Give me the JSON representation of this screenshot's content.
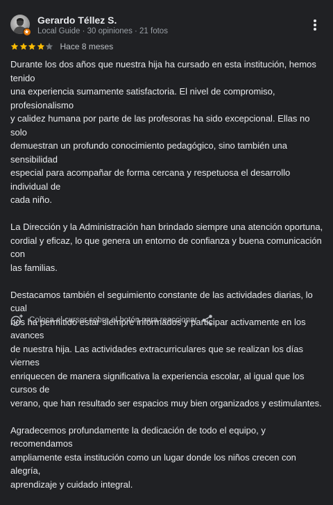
{
  "reviewer": {
    "name": "Gerardo Téllez S.",
    "meta": "Local Guide · 30 opiniones · 21 fotos"
  },
  "rating": {
    "stars": 4,
    "max": 5,
    "time_ago": "Hace 8 meses"
  },
  "review": {
    "paragraphs": [
      "Durante los dos años que nuestra hija ha cursado en esta institución, hemos tenido\nuna experiencia sumamente satisfactoria. El nivel de compromiso, profesionalismo\ny calidez humana por parte de las profesoras ha sido excepcional. Ellas no solo\ndemuestran un profundo conocimiento pedagógico, sino también una sensibilidad\nespecial para acompañar de forma cercana y respetuosa el desarrollo individual de\ncada niño.",
      "La Dirección y la Administración han brindado siempre una atención oportuna,\ncordial y eficaz, lo que genera un entorno de confianza y buena comunicación con\nlas familias.",
      "Destacamos también el seguimiento constante de las actividades diarias, lo cual\nnos ha permitido estar siempre informados y participar activamente en los avances\nde nuestra hija. Las actividades extracurriculares que se realizan los días viernes\nenriquecen de manera significativa la experiencia escolar, al igual que los cursos de\nverano, que han resultado ser espacios muy bien organizados y estimulantes.",
      "Agradecemos profundamente la dedicación de todo el equipo, y recomendamos\nampliamente esta institución como un lugar donde los niños crecen con alegría,\naprendizaje y cuidado integral."
    ]
  },
  "footer": {
    "react_hint": "Coloca el cursor sobre el botón para reaccionar"
  },
  "icons": {
    "more": "more-vert-icon",
    "react": "add-reaction-icon",
    "share": "share-icon",
    "badge": "local-guide-star-icon"
  },
  "colors": {
    "background": "#202124",
    "star_filled": "#fbbc04",
    "star_empty": "#70757a",
    "badge": "#e37400",
    "text_primary": "#e8eaed",
    "text_secondary": "#9aa0a6"
  }
}
